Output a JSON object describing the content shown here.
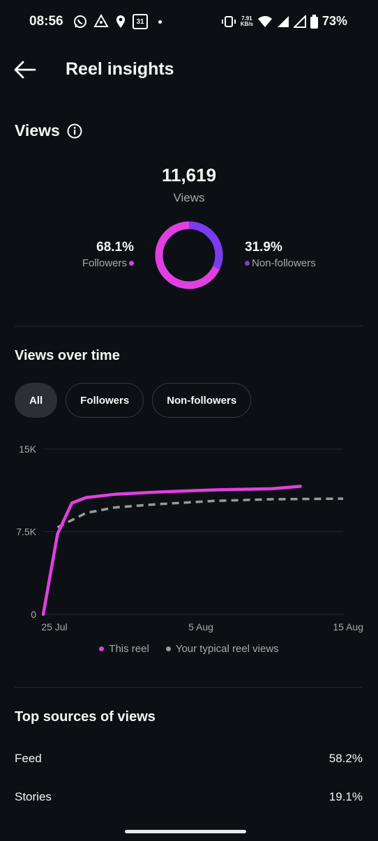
{
  "status_bar": {
    "time": "08:56",
    "calendar_day": "31",
    "net_speed_value": "7.91",
    "net_speed_unit": "KB/s",
    "battery": "73%"
  },
  "header": {
    "title": "Reel insights"
  },
  "views": {
    "title": "Views",
    "total": "11,619",
    "total_label": "Views",
    "followers_pct": "68.1%",
    "followers_label": "Followers",
    "nonfollowers_pct": "31.9%",
    "nonfollowers_label": "Non-followers",
    "donut": {
      "followers_fraction": 0.681,
      "nonfollowers_fraction": 0.319
    },
    "colors": {
      "followers": "#e040e0",
      "nonfollowers": "#7a3cf0"
    }
  },
  "views_over_time": {
    "title": "Views over time",
    "filters": [
      {
        "label": "All",
        "active": true
      },
      {
        "label": "Followers",
        "active": false
      },
      {
        "label": "Non-followers",
        "active": false
      }
    ]
  },
  "chart_data": {
    "type": "line",
    "title": "",
    "xlabel": "",
    "ylabel": "",
    "y_tick_labels": [
      "15K",
      "7.5K",
      "0"
    ],
    "x_tick_labels": [
      "25 Jul",
      "5 Aug",
      "15 Aug"
    ],
    "ylim": [
      0,
      15000
    ],
    "xlim": [
      "2024-07-25",
      "2024-08-15"
    ],
    "grid": true,
    "legend_position": "bottom",
    "series": [
      {
        "name": "This reel",
        "color": "#e040e0",
        "style": "solid",
        "points": [
          {
            "x": "2024-07-25",
            "y": 0
          },
          {
            "x": "2024-07-26",
            "y": 7300
          },
          {
            "x": "2024-07-27",
            "y": 10100
          },
          {
            "x": "2024-07-28",
            "y": 10600
          },
          {
            "x": "2024-07-30",
            "y": 10900
          },
          {
            "x": "2024-08-02",
            "y": 11100
          },
          {
            "x": "2024-08-06",
            "y": 11300
          },
          {
            "x": "2024-08-10",
            "y": 11400
          },
          {
            "x": "2024-08-12",
            "y": 11619
          }
        ]
      },
      {
        "name": "Your typical reel views",
        "color": "#9a9a9a",
        "style": "dashed",
        "points": [
          {
            "x": "2024-07-26",
            "y": 7900
          },
          {
            "x": "2024-07-28",
            "y": 9200
          },
          {
            "x": "2024-07-30",
            "y": 9700
          },
          {
            "x": "2024-08-02",
            "y": 10000
          },
          {
            "x": "2024-08-06",
            "y": 10300
          },
          {
            "x": "2024-08-10",
            "y": 10450
          },
          {
            "x": "2024-08-15",
            "y": 10500
          }
        ]
      }
    ]
  },
  "top_sources": {
    "title": "Top sources of views",
    "rows": [
      {
        "label": "Feed",
        "value": "58.2%"
      },
      {
        "label": "Stories",
        "value": "19.1%"
      }
    ]
  }
}
